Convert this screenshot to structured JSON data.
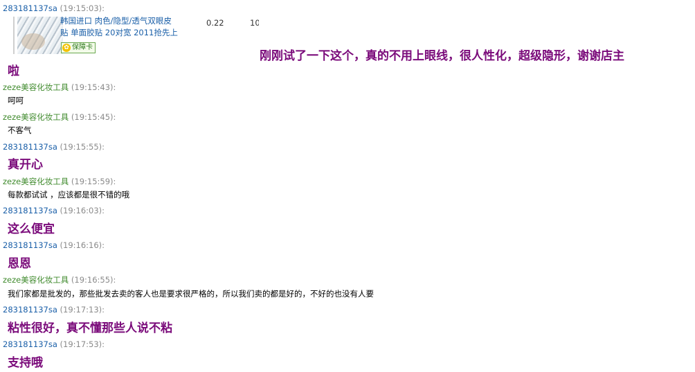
{
  "messages": [
    {
      "sender": "283181137sa",
      "time": "(19:15:03):",
      "role": "buyer"
    },
    {
      "sender": "zeze美容化妆工具",
      "time": "(19:15:43):",
      "role": "seller",
      "text": "呵呵"
    },
    {
      "sender": "zeze美容化妆工具",
      "time": "(19:15:45):",
      "role": "seller",
      "text": "不客气"
    },
    {
      "sender": "283181137sa",
      "time": "(19:15:55):",
      "role": "buyer",
      "text": "真开心"
    },
    {
      "sender": "zeze美容化妆工具",
      "time": "(19:15:59):",
      "role": "seller",
      "text": "每款都试试 ，应该都是很不错的哦"
    },
    {
      "sender": "283181137sa",
      "time": "(19:16:03):",
      "role": "buyer",
      "text": "这么便宜"
    },
    {
      "sender": "283181137sa",
      "time": "(19:16:16):",
      "role": "buyer",
      "text": "恩恩"
    },
    {
      "sender": "zeze美容化妆工具",
      "time": "(19:16:55):",
      "role": "seller",
      "text": "我们家都是批发的，那些批发去卖的客人也是要求很严格的，所以我们卖的都是好的，不好的也没有人要"
    },
    {
      "sender": "283181137sa",
      "time": "(19:17:13):",
      "role": "buyer",
      "text": "粘性很好，真不懂那些人说不粘"
    },
    {
      "sender": "283181137sa",
      "time": "(19:17:53):",
      "role": "buyer",
      "text": "支持哦"
    }
  ],
  "product": {
    "title_line1": "韩国进口 肉色/隐型/透气双眼皮",
    "title_line2": "贴 单面胶贴 20对宽 2011抢先上",
    "badge": "保障卡",
    "price": "0.22",
    "qty": "10"
  },
  "first_message_line1": "刚刚试了一下这个，真的不用上眼线，很人性化，超级隐形，谢谢店主",
  "first_message_line2": "啦"
}
